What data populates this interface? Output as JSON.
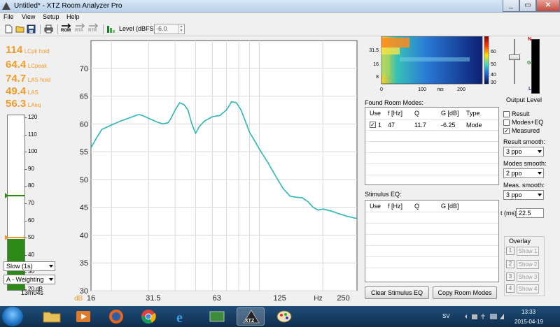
{
  "window": {
    "title": "Untitled* - XTZ Room Analyzer Pro",
    "minimize": "_",
    "maximize": "▭",
    "close": "✕"
  },
  "menu": [
    "File",
    "View",
    "Setup",
    "Help"
  ],
  "toolbar": {
    "new": "new-file-icon",
    "open": "open-folder-icon",
    "save": "save-icon",
    "print": "print-icon",
    "rom": "ROM",
    "rta": "RTA",
    "rtr": "RTR",
    "level_label": "Level (dBFS)",
    "level_value": "-6.0"
  },
  "meter_readings": [
    {
      "value": "114",
      "unit": "LCpk hold"
    },
    {
      "value": "64.4",
      "unit": "LCpeak"
    },
    {
      "value": "74.7",
      "unit": "LAS hold"
    },
    {
      "value": "49.4",
      "unit": "LAS"
    },
    {
      "value": "56.3",
      "unit": "LAeq"
    }
  ],
  "meter_scale": [
    "120",
    "110",
    "100",
    "90",
    "80",
    "70",
    "60",
    "50",
    "40",
    "30",
    "20 dB"
  ],
  "meter": {
    "range": [
      20,
      120
    ],
    "level": 49.4,
    "hold": 74.7,
    "peak_marker": 51,
    "fill_color": "#2e8a16"
  },
  "left_controls": {
    "speed": "Slow (1s)",
    "weighting": "A - Weighting",
    "elapsed": "13m04s"
  },
  "chart_data": {
    "type": "line",
    "xscale": "log",
    "xlim": [
      16,
      290
    ],
    "ylim": [
      30,
      75
    ],
    "x_ticks": [
      "16",
      "31.5",
      "63",
      "125",
      "250"
    ],
    "x_unit": "Hz",
    "y_ticks": [
      "30",
      "35",
      "40",
      "45",
      "50",
      "55",
      "60",
      "65",
      "70"
    ],
    "y_unit": "dB",
    "grid": true,
    "line_color": "#2cb5b5",
    "series": [
      {
        "x": [
          16,
          17,
          18,
          20,
          22,
          24,
          26,
          27,
          28,
          30,
          33,
          35,
          37,
          38,
          40,
          42,
          44,
          46,
          48,
          50,
          52,
          55,
          60,
          65,
          70,
          74,
          78,
          82,
          85,
          90,
          95,
          100,
          110,
          120,
          130,
          140,
          150,
          160,
          170,
          180,
          190,
          200,
          220,
          240,
          260,
          280,
          290
        ],
        "y": [
          55.7,
          57.5,
          59,
          59.8,
          60.5,
          61,
          61.5,
          61.7,
          61.5,
          61,
          60.3,
          60,
          60.2,
          60.8,
          62.5,
          63.8,
          63.5,
          62.5,
          60,
          58.3,
          59.5,
          60.5,
          61.3,
          61.5,
          62.5,
          64,
          63.8,
          62.5,
          61,
          58.5,
          57,
          55.5,
          53,
          50.5,
          48.3,
          47,
          46.8,
          46.7,
          46,
          45,
          44.5,
          44.7,
          44.3,
          43.8,
          43.4,
          43.1,
          43
        ]
      }
    ]
  },
  "decay_plot": {
    "y_ticks": [
      "63",
      "31.5",
      "16",
      "8"
    ],
    "x_ticks": [
      "0",
      "100",
      "200"
    ],
    "x_unit": "ms",
    "color_ticks": [
      "60",
      "50",
      "40",
      "30"
    ]
  },
  "output_level": {
    "label": "Output Level",
    "n": "N",
    "g": "G",
    "l": "L"
  },
  "room_modes": {
    "label": "Found Room Modes:",
    "headers": [
      "Use",
      "f [Hz]",
      "Q",
      "G [dB]",
      "Type"
    ],
    "rows": [
      {
        "use": "1",
        "f": "47",
        "q": "11.7",
        "g": "-6.25",
        "type": "Mode",
        "checked": true
      }
    ]
  },
  "stimulus_eq": {
    "label": "Stimulus EQ:",
    "headers": [
      "Use",
      "f [Hz]",
      "Q",
      "G [dB]"
    ]
  },
  "buttons": {
    "clear": "Clear Stimulus EQ",
    "copy": "Copy Room Modes"
  },
  "options": {
    "result": "Result",
    "modes_eq": "Modes+EQ",
    "measured": "Measured",
    "result_smooth_label": "Result smooth:",
    "result_smooth": "3 ppo",
    "modes_smooth_label": "Modes smooth:",
    "modes_smooth": "2 ppo",
    "meas_smooth_label": "Meas. smooth:",
    "meas_smooth": "3 ppo",
    "t_label": "t (ms)",
    "t_value": "22.5"
  },
  "overlay": {
    "label": "Overlay",
    "items": [
      {
        "n": "1",
        "label": "Show 1"
      },
      {
        "n": "2",
        "label": "Show 2"
      },
      {
        "n": "3",
        "label": "Show 3"
      },
      {
        "n": "4",
        "label": "Show 4"
      }
    ]
  },
  "taskbar": {
    "lang": "SV",
    "time": "13:33",
    "date": "2015-04-19",
    "xtz": "XTZ"
  }
}
